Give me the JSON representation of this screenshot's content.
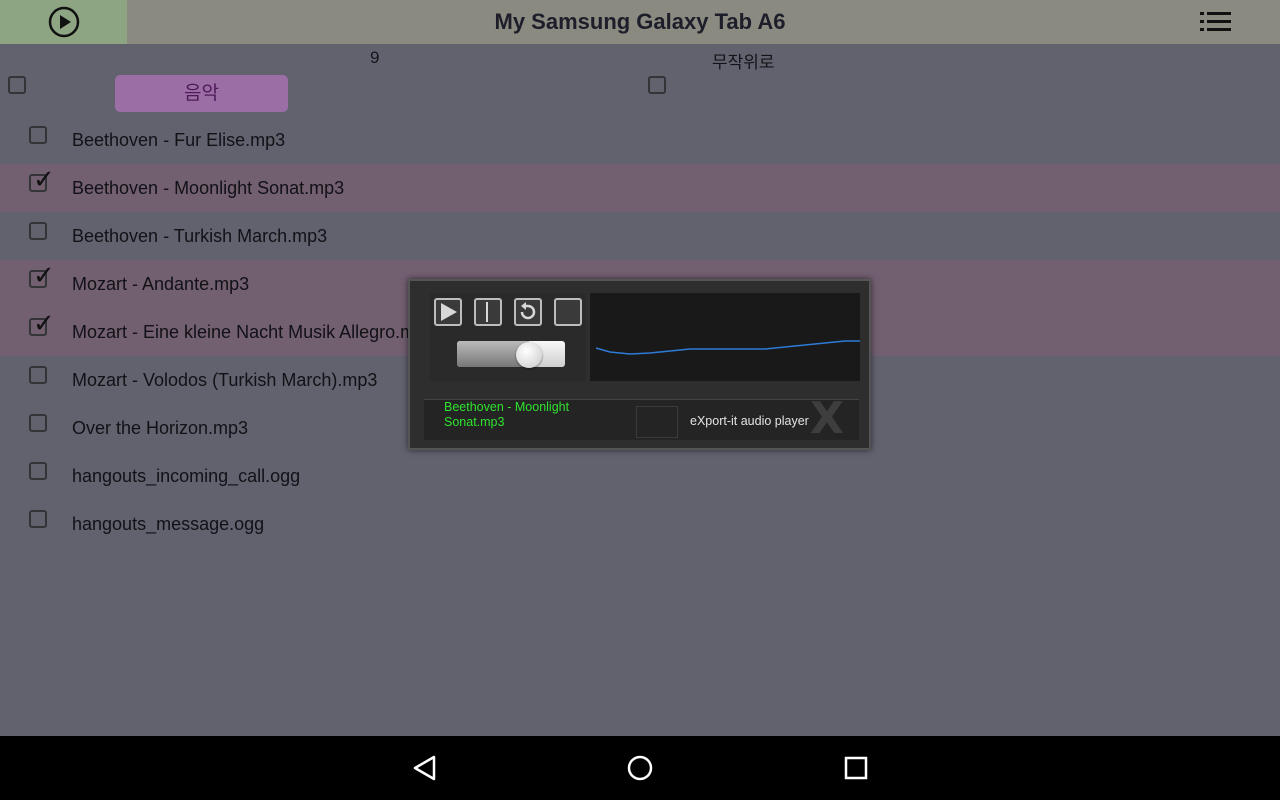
{
  "header": {
    "title": "My Samsung Galaxy Tab A6",
    "play_icon": "play-circle-icon",
    "menu_icon": "list-menu-icon"
  },
  "toolbar": {
    "count": "9",
    "shuffle_label": "무작위로",
    "music_button": "음악"
  },
  "files": [
    {
      "name": "Beethoven - Fur Elise.mp3",
      "checked": false
    },
    {
      "name": "Beethoven - Moonlight Sonat.mp3",
      "checked": true
    },
    {
      "name": "Beethoven - Turkish March.mp3",
      "checked": false
    },
    {
      "name": "Mozart - Andante.mp3",
      "checked": true
    },
    {
      "name": "Mozart - Eine kleine Nacht Musik Allegro.mp3",
      "checked": true
    },
    {
      "name": "Mozart - Volodos (Turkish March).mp3",
      "checked": false
    },
    {
      "name": "Over the Horizon.mp3",
      "checked": false
    },
    {
      "name": "hangouts_incoming_call.ogg",
      "checked": false
    },
    {
      "name": "hangouts_message.ogg",
      "checked": false
    }
  ],
  "player": {
    "now_playing": "Beethoven - Moonlight Sonat.mp3",
    "brand": "eXport-it audio player",
    "volume": 0.67,
    "close_glyph": "X",
    "controls": [
      "play-icon",
      "pause-icon",
      "repeat-icon",
      "stop-icon"
    ]
  },
  "colors": {
    "accent_green": "#2fe22f",
    "selected_row": "#725f70",
    "music_button": "#9b6fa5",
    "waveform": "#2e7bd6"
  },
  "navbar": {
    "icons": [
      "back-icon",
      "home-icon",
      "recents-icon"
    ]
  }
}
